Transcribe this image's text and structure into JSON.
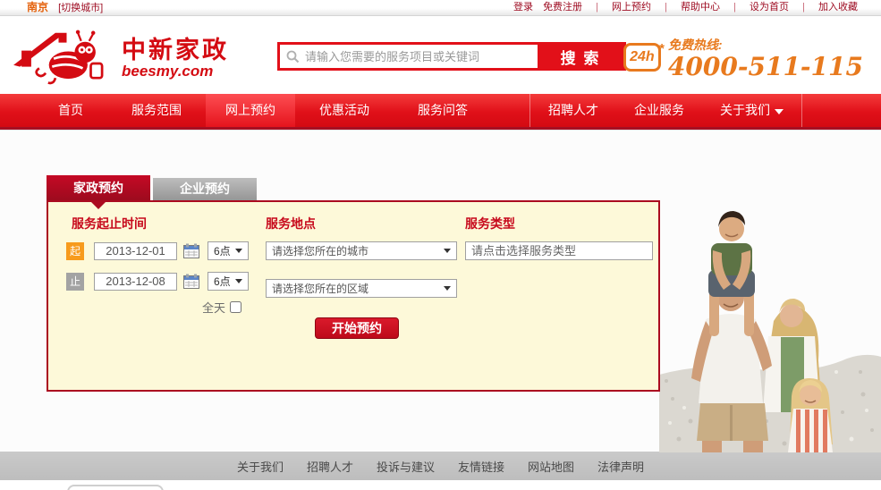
{
  "topbar": {
    "city": "南京",
    "switch_city": "[切换城市]",
    "separator": "|",
    "links": [
      "登录",
      "免费注册",
      "网上预约",
      "帮助中心",
      "设为首页",
      "加入收藏"
    ]
  },
  "header": {
    "brand_cn": "中新家政",
    "brand_domain": "beesmy.com",
    "search_placeholder": "请输入您需要的服务项目或关键词",
    "search_button": "搜 索",
    "hotline_badge": "24h",
    "hotline_label": "免费热线:",
    "hotline_number": "4000-511-115"
  },
  "nav": {
    "items": [
      "首页",
      "服务范围",
      "网上预约",
      "优惠活动",
      "服务问答"
    ],
    "active_item": "网上预约",
    "right_items": [
      "招聘人才",
      "企业服务",
      "关于我们"
    ]
  },
  "booking": {
    "tabs": {
      "home": "家政预约",
      "company": "企业预约"
    },
    "time": {
      "title": "服务起止时间",
      "start_label": "起",
      "start_date": "2013-12-01",
      "start_hour": "6点",
      "end_label": "止",
      "end_date": "2013-12-08",
      "end_hour": "6点",
      "all_day_label": "全天",
      "all_day_checked": false
    },
    "location": {
      "title": "服务地点",
      "city_placeholder": "请选择您所在的城市",
      "district_placeholder": "请选择您所在的区域"
    },
    "type": {
      "title": "服务类型",
      "placeholder": "请点击选择服务类型"
    },
    "submit_label": "开始预约"
  },
  "footer": {
    "links": [
      "关于我们",
      "招聘人才",
      "投诉与建议",
      "友情链接",
      "网站地图",
      "法律声明"
    ]
  },
  "colors": {
    "brand_red": "#d40b12",
    "nav_dark_red": "#a60f22",
    "link_dark_red": "#9e0c22",
    "orange": "#e87a1e",
    "badge_orange": "#f79b1d",
    "panel_yellow": "#fdf9d9",
    "panel_border_red": "#ab0b20",
    "footer_gray": "#c3c3c3"
  }
}
